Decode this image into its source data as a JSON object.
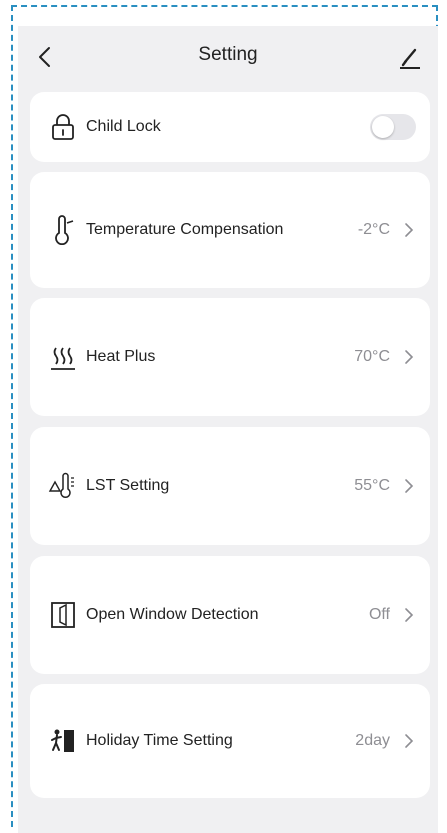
{
  "header": {
    "title": "Setting",
    "back_icon": "chevron-left-icon",
    "edit_icon": "pencil-icon"
  },
  "settings": [
    {
      "label": "Child Lock",
      "icon": "lock-icon",
      "control": "toggle",
      "toggle_on": false
    },
    {
      "label": "Temperature Compensation",
      "icon": "thermometer-icon",
      "value": "-2°C"
    },
    {
      "label": "Heat Plus",
      "icon": "heat-waves-icon",
      "value": "70°C"
    },
    {
      "label": "LST Setting",
      "icon": "lst-warning-thermometer-icon",
      "value": "55°C"
    },
    {
      "label": "Open Window Detection",
      "icon": "open-window-icon",
      "value": "Off"
    },
    {
      "label": "Holiday Time Setting",
      "icon": "holiday-walking-icon",
      "value": "2day"
    }
  ],
  "colors": {
    "background": "#f0f0f2",
    "card": "#ffffff",
    "value_text": "#8e8e93",
    "toggle_off": "#e6e6ea",
    "frame_dash": "#2a8fc1"
  }
}
